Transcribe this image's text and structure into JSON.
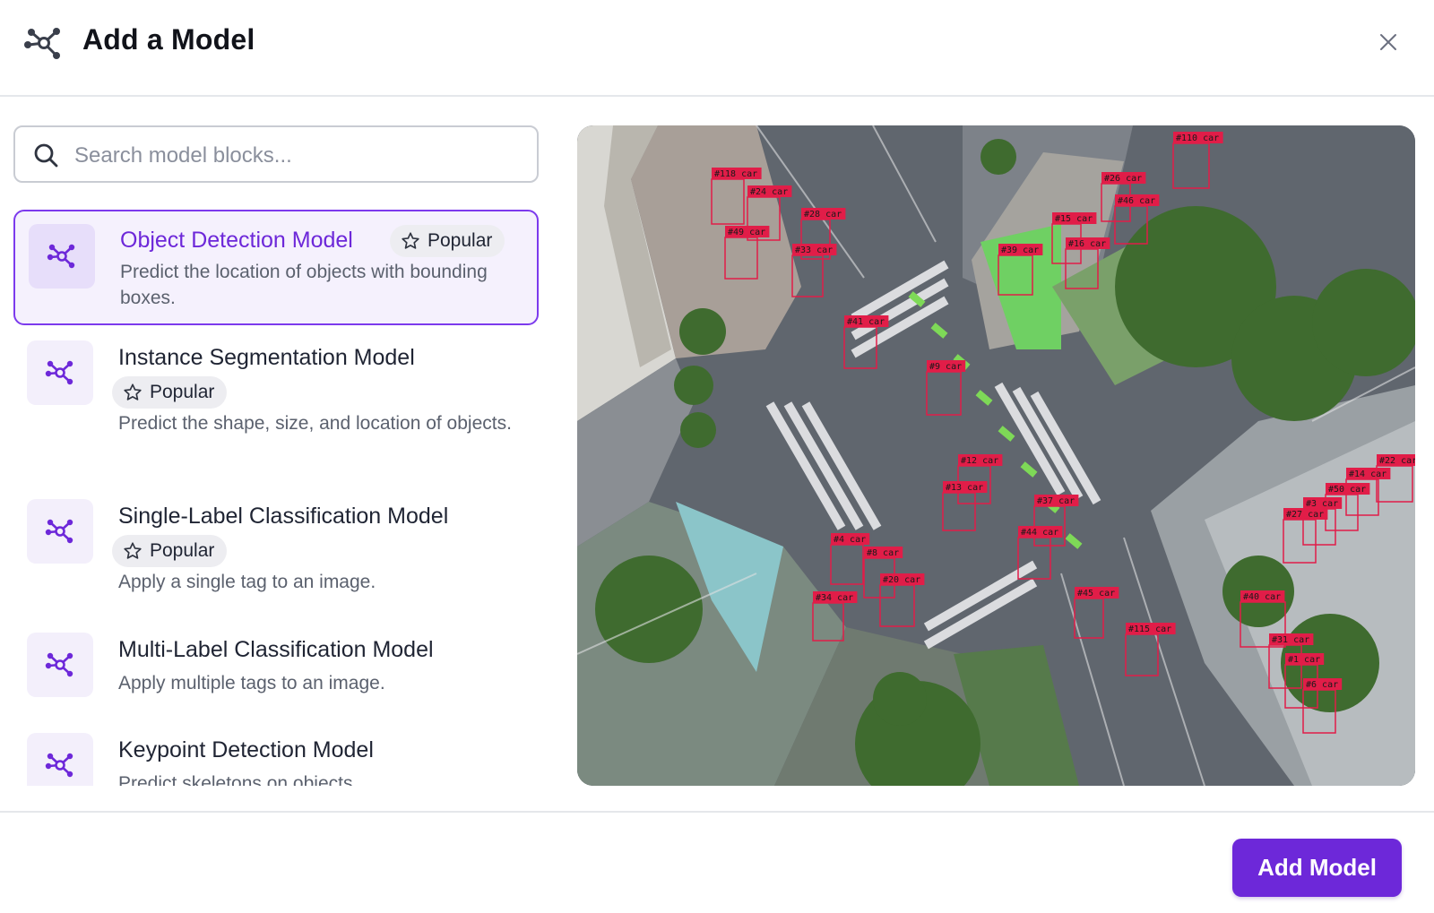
{
  "dialog": {
    "title": "Add a Model",
    "logo_icon": "model-graph-icon",
    "close_icon": "close-icon"
  },
  "search": {
    "placeholder": "Search model blocks...",
    "value": "",
    "icon": "search-icon"
  },
  "models": [
    {
      "name": "Object Detection Model",
      "badge": "Popular",
      "description": "Predict the location of objects with bounding boxes.",
      "selected": true
    },
    {
      "name": "Instance Segmentation Model",
      "badge": "Popular",
      "description": "Predict the shape, size, and location of objects.",
      "selected": false
    },
    {
      "name": "Single-Label Classification Model",
      "badge": "Popular",
      "description": "Apply a single tag to an image.",
      "selected": false
    },
    {
      "name": "Multi-Label Classification Model",
      "badge": "",
      "description": "Apply multiple tags to an image.",
      "selected": false
    },
    {
      "name": "Keypoint Detection Model",
      "badge": "",
      "description": "Predict skeletons on objects.",
      "selected": false
    }
  ],
  "preview": {
    "detections": [
      {
        "label": "#118 car"
      },
      {
        "label": "#24 car"
      },
      {
        "label": "#49 car"
      },
      {
        "label": "#28 car"
      },
      {
        "label": "#33 car"
      },
      {
        "label": "#41 car"
      },
      {
        "label": "#9 car"
      },
      {
        "label": "#39 car"
      },
      {
        "label": "#15 car"
      },
      {
        "label": "#16 car"
      },
      {
        "label": "#26 car"
      },
      {
        "label": "#46 car"
      },
      {
        "label": "#110 car"
      },
      {
        "label": "#12 car"
      },
      {
        "label": "#13 car"
      },
      {
        "label": "#37 car"
      },
      {
        "label": "#44 car"
      },
      {
        "label": "#4 car"
      },
      {
        "label": "#8 car"
      },
      {
        "label": "#20 car"
      },
      {
        "label": "#34 car"
      },
      {
        "label": "#45 car"
      },
      {
        "label": "#115 car"
      },
      {
        "label": "#22 car"
      },
      {
        "label": "#14 car"
      },
      {
        "label": "#50 car"
      },
      {
        "label": "#3 car"
      },
      {
        "label": "#27 car"
      },
      {
        "label": "#40 car"
      },
      {
        "label": "#31 car"
      },
      {
        "label": "#1 car"
      },
      {
        "label": "#6 car"
      }
    ],
    "box_color": "#e11d48"
  },
  "footer": {
    "add_button_label": "Add Model"
  },
  "colors": {
    "accent": "#6d28d9",
    "selected_bg": "#f5f1fd",
    "badge_bg": "#ededf1"
  }
}
